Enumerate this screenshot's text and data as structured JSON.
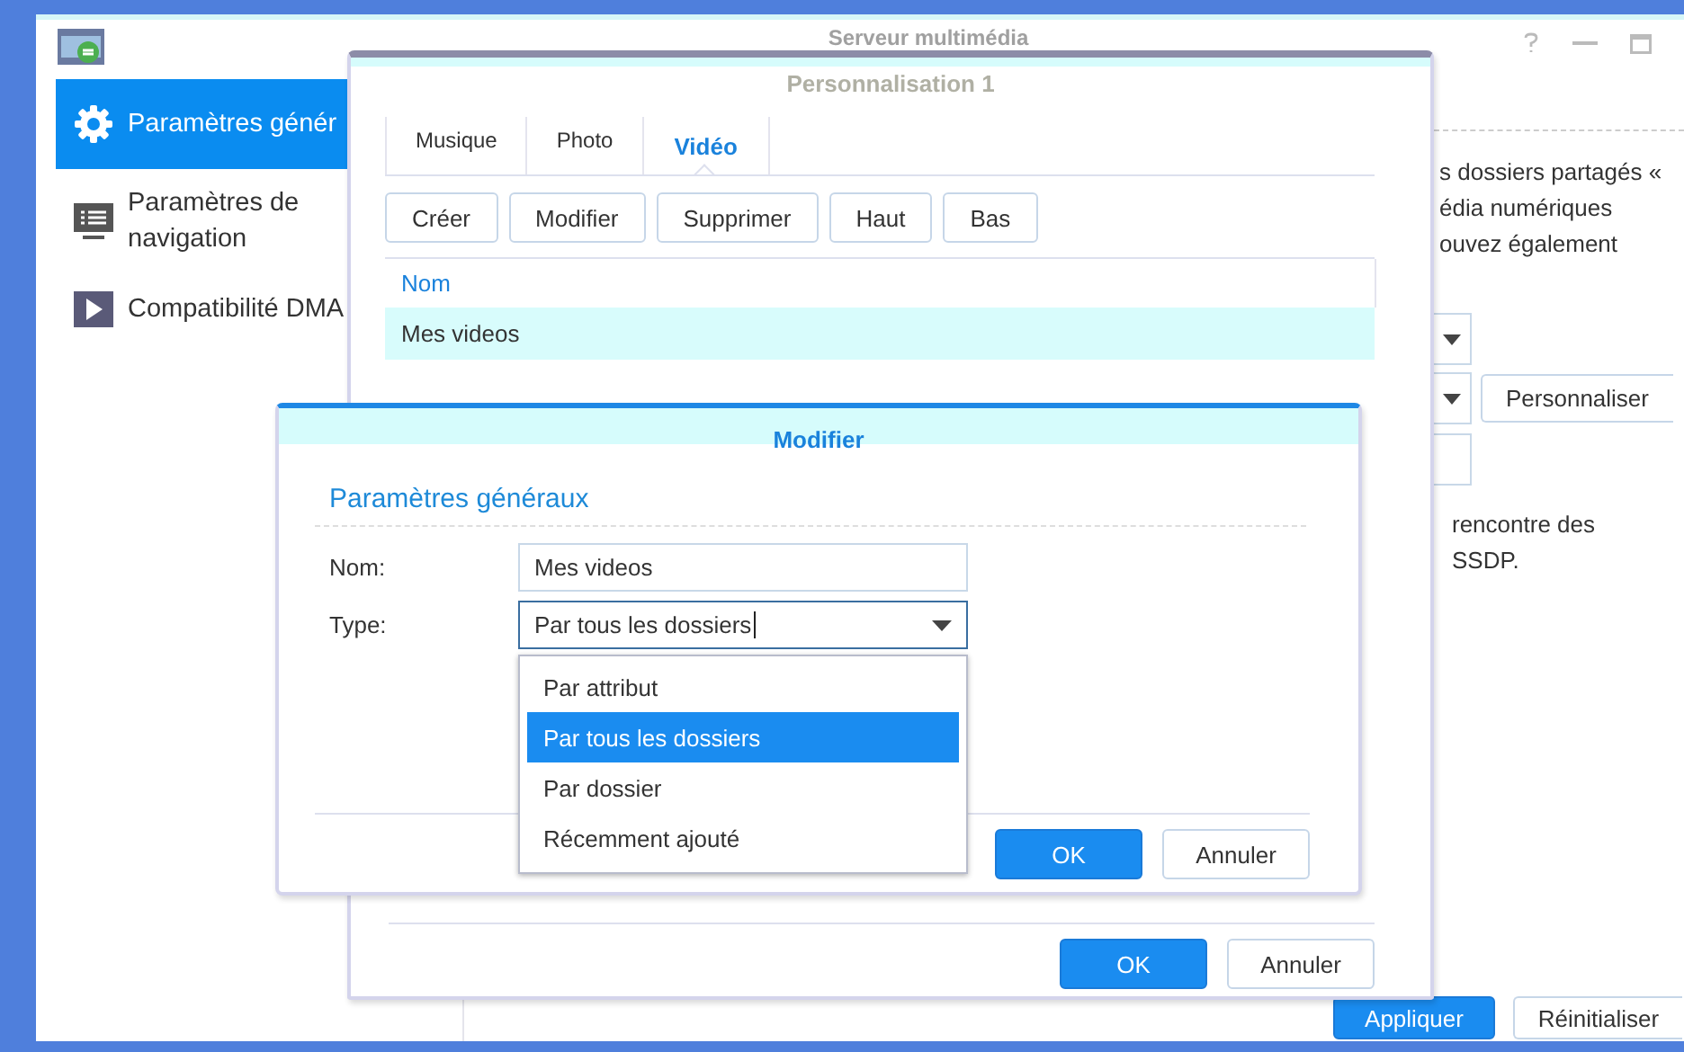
{
  "window": {
    "title": "Serveur multimédia"
  },
  "sidebar": {
    "items": [
      {
        "label": "Paramètres génér",
        "selected": true
      },
      {
        "label": "Paramètres de navigation",
        "selected": false
      },
      {
        "label": "Compatibilité DMA",
        "selected": false
      }
    ]
  },
  "content": {
    "description_lines": [
      "s dossiers partagés «",
      "édia numériques",
      "ouvez également"
    ],
    "customize_button": "Personnaliser",
    "note_lines": [
      "rencontre des",
      "SSDP."
    ],
    "apply_button": "Appliquer",
    "reset_button": "Réinitialiser"
  },
  "customization_dialog": {
    "title": "Personnalisation 1",
    "tabs": [
      {
        "label": "Musique",
        "selected": false
      },
      {
        "label": "Photo",
        "selected": false
      },
      {
        "label": "Vidéo",
        "selected": true
      }
    ],
    "toolbar": [
      "Créer",
      "Modifier",
      "Supprimer",
      "Haut",
      "Bas"
    ],
    "table": {
      "columns": [
        "Nom"
      ],
      "rows": [
        {
          "name": "Mes videos",
          "selected": true
        }
      ]
    },
    "ok_button": "OK",
    "cancel_button": "Annuler"
  },
  "edit_dialog": {
    "title": "Modifier",
    "section": "Paramètres généraux",
    "name_label": "Nom:",
    "name_value": "Mes videos",
    "type_label": "Type:",
    "type_value": "Par tous les dossiers",
    "type_options": [
      {
        "label": "Par attribut",
        "selected": false
      },
      {
        "label": "Par tous les dossiers",
        "selected": true
      },
      {
        "label": "Par dossier",
        "selected": false
      },
      {
        "label": "Récemment ajouté",
        "selected": false
      }
    ],
    "ok_button": "OK",
    "cancel_button": "Annuler"
  }
}
